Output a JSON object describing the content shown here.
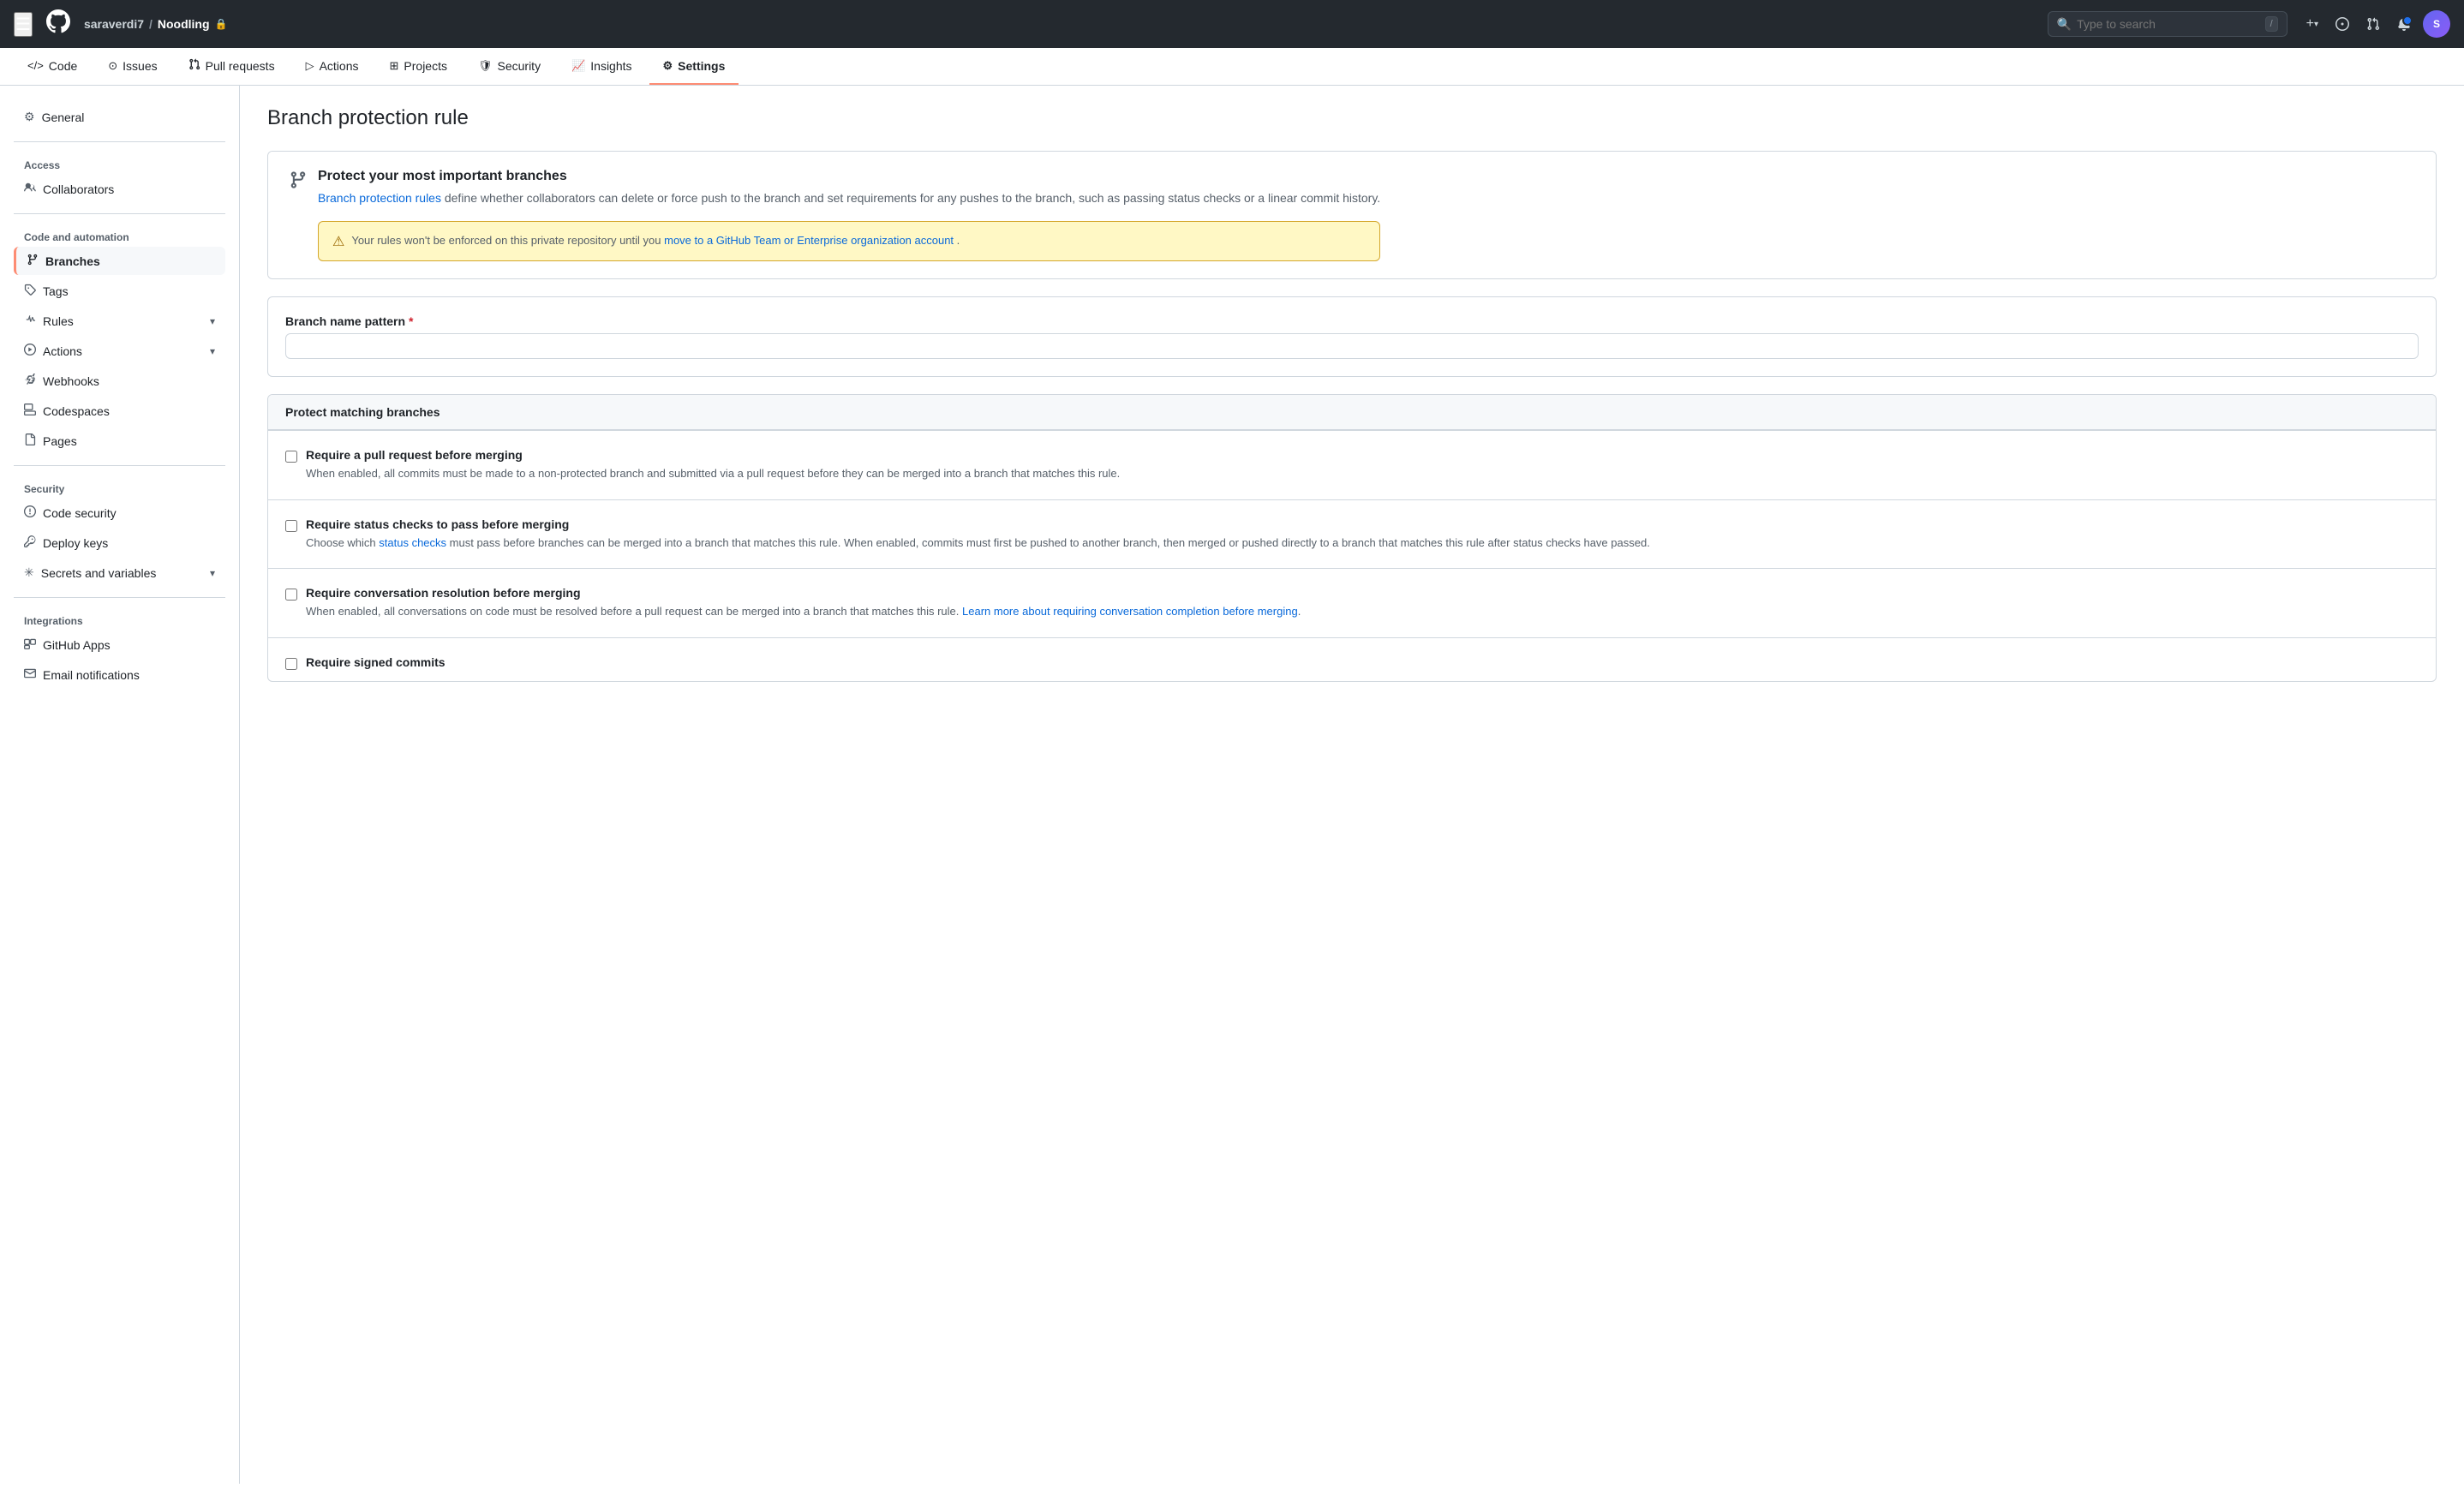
{
  "topnav": {
    "hamburger": "☰",
    "logo": "🐙",
    "breadcrumb": {
      "user": "saraverdi7",
      "separator": "/",
      "repo": "Noodling",
      "lock": "🔒"
    },
    "search_placeholder": "Type to search",
    "search_kbd": "/",
    "icons": {
      "plus": "+",
      "plus_dropdown": "▾",
      "circle": "○",
      "pull_request": "⇄",
      "inbox": "✉",
      "avatar_text": "S"
    }
  },
  "tabs": [
    {
      "id": "code",
      "icon": "</>",
      "label": "Code"
    },
    {
      "id": "issues",
      "icon": "●",
      "label": "Issues"
    },
    {
      "id": "pull-requests",
      "icon": "⇄",
      "label": "Pull requests"
    },
    {
      "id": "actions",
      "icon": "▷",
      "label": "Actions"
    },
    {
      "id": "projects",
      "icon": "⊞",
      "label": "Projects"
    },
    {
      "id": "security",
      "icon": "🛡",
      "label": "Security"
    },
    {
      "id": "insights",
      "icon": "📈",
      "label": "Insights"
    },
    {
      "id": "settings",
      "icon": "⚙",
      "label": "Settings"
    }
  ],
  "sidebar": {
    "items": [
      {
        "id": "general",
        "icon": "⚙",
        "label": "General",
        "section": null
      },
      {
        "id": "collaborators",
        "icon": "👤",
        "label": "Collaborators",
        "section": "Access"
      },
      {
        "id": "branches",
        "icon": "⎇",
        "label": "Branches",
        "section": "Code and automation",
        "active": true
      },
      {
        "id": "tags",
        "icon": "🏷",
        "label": "Tags",
        "section": null
      },
      {
        "id": "rules",
        "icon": "📋",
        "label": "Rules",
        "section": null,
        "hasChevron": true
      },
      {
        "id": "actions",
        "icon": "▷",
        "label": "Actions",
        "section": null,
        "hasChevron": true
      },
      {
        "id": "webhooks",
        "icon": "🔗",
        "label": "Webhooks",
        "section": null
      },
      {
        "id": "codespaces",
        "icon": "⬛",
        "label": "Codespaces",
        "section": null
      },
      {
        "id": "pages",
        "icon": "📄",
        "label": "Pages",
        "section": null
      },
      {
        "id": "code-security",
        "icon": "🔍",
        "label": "Code security",
        "section": "Security"
      },
      {
        "id": "deploy-keys",
        "icon": "🔑",
        "label": "Deploy keys",
        "section": null
      },
      {
        "id": "secrets-variables",
        "icon": "✳",
        "label": "Secrets and variables",
        "section": null,
        "hasChevron": true
      },
      {
        "id": "github-apps",
        "icon": "⊞",
        "label": "GitHub Apps",
        "section": "Integrations"
      },
      {
        "id": "email-notifications",
        "icon": "✉",
        "label": "Email notifications",
        "section": null
      }
    ],
    "sections": [
      "Access",
      "Code and automation",
      "Security",
      "Integrations"
    ]
  },
  "page": {
    "title": "Branch protection rule",
    "info_card": {
      "icon": "⎇",
      "heading": "Protect your most important branches",
      "link_text": "Branch protection rules",
      "desc1": " define whether collaborators can delete or force push to the branch and set requirements for any pushes to the branch, such as passing status checks or a linear commit history.",
      "warning_text": "Your rules won't be enforced on this private repository until you ",
      "warning_link_text": "move to a GitHub Team or Enterprise organization account",
      "warning_link_suffix": "."
    },
    "branch_name_pattern": {
      "label": "Branch name pattern",
      "required": true,
      "placeholder": ""
    },
    "protect_section": {
      "header": "Protect matching branches",
      "rules": [
        {
          "id": "require-pr",
          "label": "Require a pull request before merging",
          "desc": "When enabled, all commits must be made to a non-protected branch and submitted via a pull request before they can be merged into a branch that matches this rule.",
          "checked": false
        },
        {
          "id": "require-status",
          "label": "Require status checks to pass before merging",
          "desc_before": "Choose which ",
          "link_text": "status checks",
          "desc_after": " must pass before branches can be merged into a branch that matches this rule. When enabled, commits must first be pushed to another branch, then merged or pushed directly to a branch that matches this rule after status checks have passed.",
          "checked": false
        },
        {
          "id": "require-conversation",
          "label": "Require conversation resolution before merging",
          "desc_before": "When enabled, all conversations on code must be resolved before a pull request can be merged into a branch that matches this rule. ",
          "link_text": "Learn more about requiring conversation completion before merging",
          "desc_after": ".",
          "checked": false
        },
        {
          "id": "require-signed",
          "label": "Require signed commits",
          "checked": false
        }
      ]
    }
  }
}
